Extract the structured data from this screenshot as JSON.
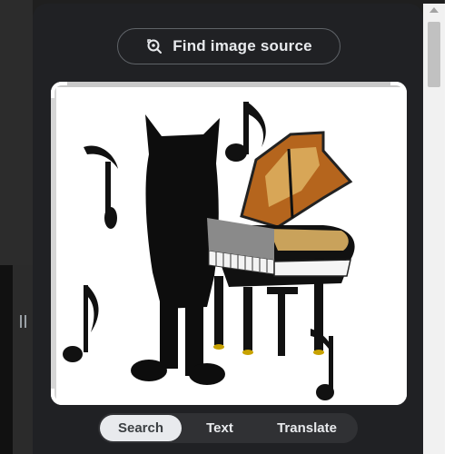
{
  "lens_panel": {
    "find_source_label": "Find image source",
    "find_source_icon": "lens-search-icon",
    "image_subject": "cat-and-grand-piano-with-music-notes",
    "modes": [
      {
        "label": "Search",
        "active": true
      },
      {
        "label": "Text",
        "active": false
      },
      {
        "label": "Translate",
        "active": false
      }
    ]
  },
  "colors": {
    "panel_bg": "#202124",
    "text_light": "#e8eaed",
    "active_tab_bg": "#e8eaed",
    "tab_bar_bg": "#303134"
  }
}
